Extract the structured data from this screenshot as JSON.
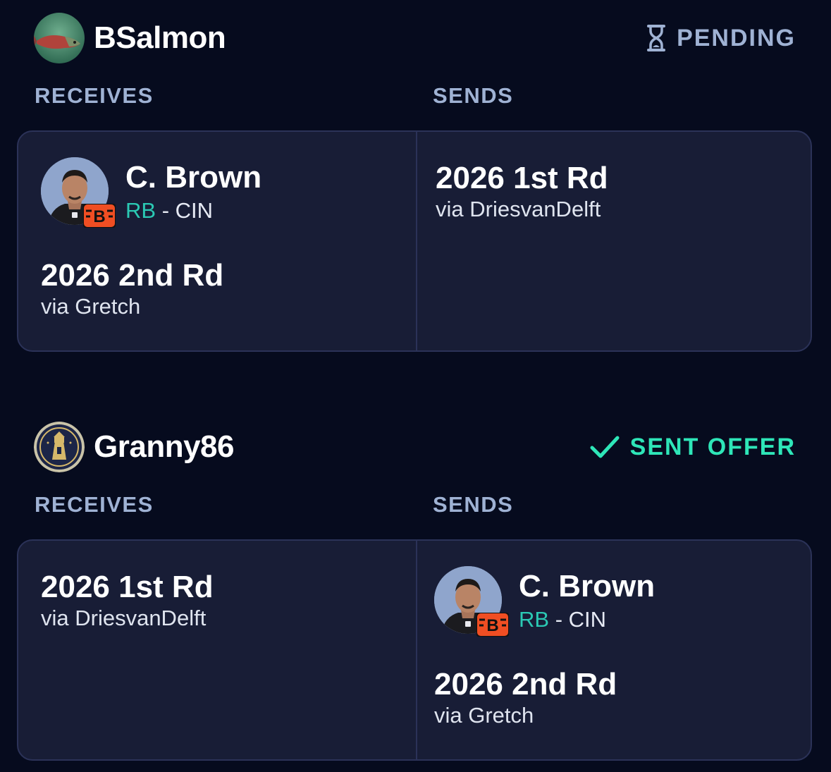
{
  "trades": [
    {
      "team_name": "BSalmon",
      "status": {
        "label": "PENDING",
        "color": "#9fb2d4",
        "icon": "hourglass-icon"
      },
      "receives_label": "RECEIVES",
      "sends_label": "SENDS",
      "receives": {
        "player": {
          "name": "C. Brown",
          "position": "RB",
          "separator": "- CIN"
        },
        "pick": {
          "title": "2026 2nd Rd",
          "via": "via Gretch"
        }
      },
      "sends": {
        "pick": {
          "title": "2026 1st Rd",
          "via": "via DriesvanDelft"
        }
      }
    },
    {
      "team_name": "Granny86",
      "status": {
        "label": "SENT OFFER",
        "color": "#2ee6b8",
        "icon": "checkmark-icon"
      },
      "receives_label": "RECEIVES",
      "sends_label": "SENDS",
      "receives": {
        "pick": {
          "title": "2026 1st Rd",
          "via": "via DriesvanDelft"
        }
      },
      "sends": {
        "player": {
          "name": "C. Brown",
          "position": "RB",
          "separator": "- CIN"
        },
        "pick": {
          "title": "2026 2nd Rd",
          "via": "via Gretch"
        }
      }
    }
  ],
  "colors": {
    "background": "#060b1e",
    "card": "#181d36",
    "position_accent": "#2bc9b4",
    "bengals_orange": "#f04e23"
  }
}
